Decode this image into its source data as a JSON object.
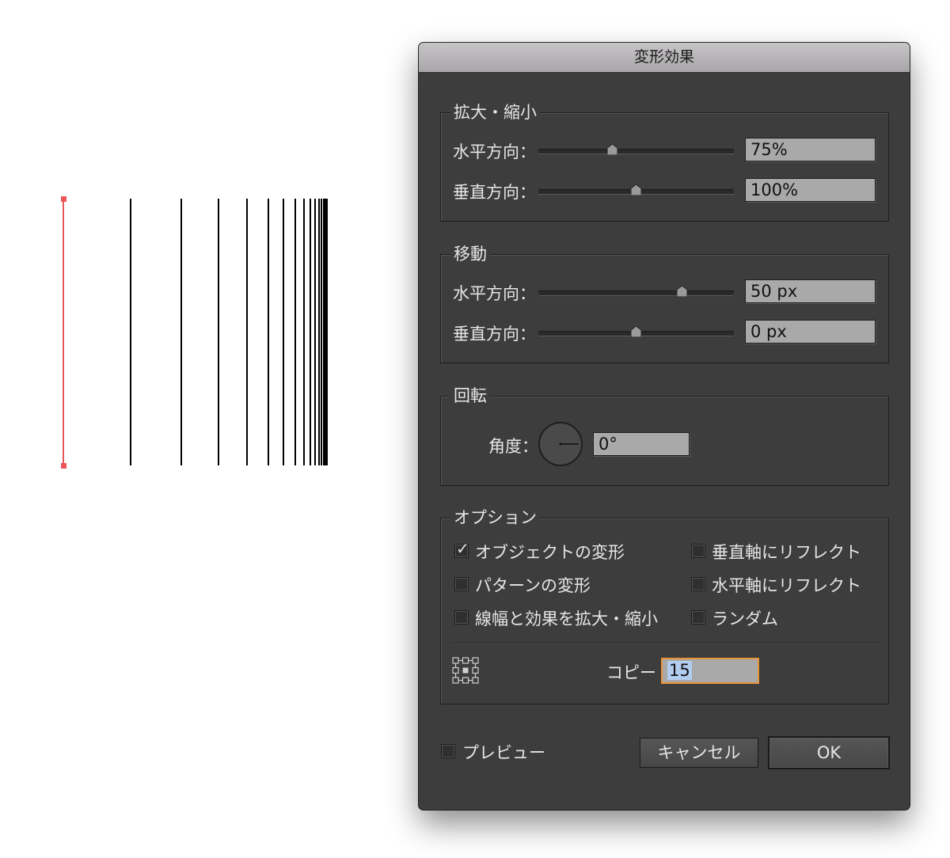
{
  "dialog": {
    "title": "変形効果",
    "scale": {
      "label": "拡大・縮小",
      "horizontal_label": "水平方向：",
      "horizontal_value": "75%",
      "vertical_label": "垂直方向：",
      "vertical_value": "100%"
    },
    "move": {
      "label": "移動",
      "horizontal_label": "水平方向：",
      "horizontal_value": "50 px",
      "vertical_label": "垂直方向：",
      "vertical_value": "0 px"
    },
    "rotate": {
      "label": "回転",
      "angle_label": "角度：",
      "angle_value": "0°"
    },
    "options": {
      "label": "オプション",
      "transform_objects": {
        "label": "オブジェクトの変形",
        "checked": true
      },
      "transform_patterns": {
        "label": "パターンの変形",
        "checked": false
      },
      "scale_strokes": {
        "label": "線幅と効果を拡大・縮小",
        "checked": false
      },
      "reflect_x": {
        "label": "垂直軸にリフレクト",
        "checked": false
      },
      "reflect_y": {
        "label": "水平軸にリフレクト",
        "checked": false
      },
      "random": {
        "label": "ランダム",
        "checked": false
      },
      "copies_label": "コピー",
      "copies_value": "15"
    },
    "preview": {
      "label": "プレビュー",
      "checked": false
    },
    "cancel_label": "キャンセル",
    "ok_label": "OK"
  },
  "colors": {
    "selection": "#e8585a",
    "dialog_bg": "#3d3d3d",
    "focus_ring": "#e8953a"
  }
}
